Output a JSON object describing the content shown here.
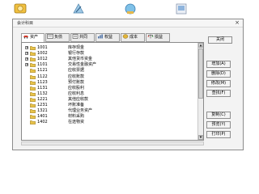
{
  "window": {
    "title": "会计科目",
    "close_label": "×"
  },
  "tabs": [
    {
      "label": "资产",
      "active": true
    },
    {
      "label": "负债",
      "active": false
    },
    {
      "label": "共同",
      "active": false
    },
    {
      "label": "权益",
      "active": false
    },
    {
      "label": "成本",
      "active": false
    },
    {
      "label": "损益",
      "active": false
    }
  ],
  "accounts": [
    {
      "expander": "+",
      "code": "1001",
      "name": "库存现金"
    },
    {
      "expander": "+",
      "code": "1002",
      "name": "银行存款"
    },
    {
      "expander": "+",
      "code": "1012",
      "name": "其他货币资金"
    },
    {
      "expander": "+",
      "code": "1101",
      "name": "交易性金融资产"
    },
    {
      "expander": "",
      "code": "1121",
      "name": "应收票据"
    },
    {
      "expander": "",
      "code": "1122",
      "name": "应收账款"
    },
    {
      "expander": "",
      "code": "1123",
      "name": "预付账款"
    },
    {
      "expander": "",
      "code": "1131",
      "name": "应收股利"
    },
    {
      "expander": "",
      "code": "1132",
      "name": "应收利息"
    },
    {
      "expander": "",
      "code": "1221",
      "name": "其他应收款"
    },
    {
      "expander": "",
      "code": "1231",
      "name": "坏账准备"
    },
    {
      "expander": "",
      "code": "1321",
      "name": "代理业务资产"
    },
    {
      "expander": "",
      "code": "1401",
      "name": "材料采购"
    },
    {
      "expander": "",
      "code": "1402",
      "name": "在途物资"
    }
  ],
  "buttons": {
    "close": "关闭",
    "add": "增加(A)",
    "delete": "删除(D)",
    "modify": "修改(M)",
    "find": "查找(F)",
    "copy": "复制(C)",
    "preview": "预览(Y)",
    "print": "打印(P)"
  },
  "icons": {
    "expand": "plus-box-icon",
    "folder": "folder-icon",
    "scroll_up": "arrow-up-icon",
    "scroll_down": "arrow-down-icon"
  },
  "colors": {
    "folder": "#e8c34a",
    "window_bg": "#f3f3f3",
    "list_bg": "#ffffff"
  }
}
